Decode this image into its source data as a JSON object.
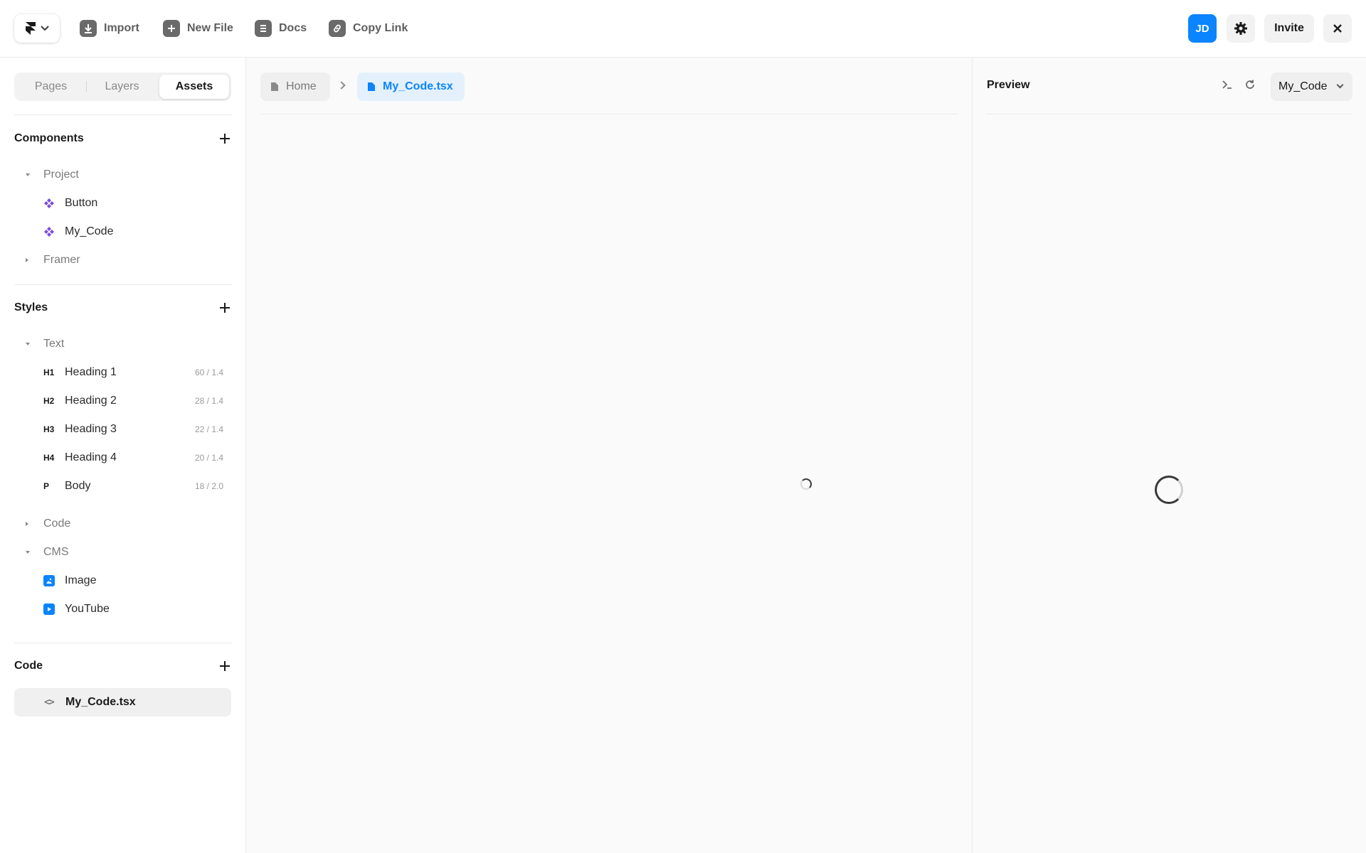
{
  "toolbar": {
    "import_label": "Import",
    "new_file_label": "New File",
    "docs_label": "Docs",
    "copy_link_label": "Copy Link",
    "avatar_initials": "JD",
    "invite_label": "Invite"
  },
  "sidebar": {
    "tabs": [
      "Pages",
      "Layers",
      "Assets"
    ],
    "active_tab": "Assets",
    "components": {
      "title": "Components",
      "project_folder": "Project",
      "items": [
        "Button",
        "My_Code"
      ],
      "framer_folder": "Framer"
    },
    "styles": {
      "title": "Styles",
      "text_folder": "Text",
      "text_styles": [
        {
          "tag": "H1",
          "name": "Heading 1",
          "meta": "60 / 1.4"
        },
        {
          "tag": "H2",
          "name": "Heading 2",
          "meta": "28 / 1.4"
        },
        {
          "tag": "H3",
          "name": "Heading 3",
          "meta": "22 / 1.4"
        },
        {
          "tag": "H4",
          "name": "Heading 4",
          "meta": "20 / 1.4"
        },
        {
          "tag": "P",
          "name": "Body",
          "meta": "18 / 2.0"
        }
      ],
      "code_folder": "Code",
      "cms_folder": "CMS",
      "cms_items": [
        "Image",
        "YouTube"
      ]
    },
    "code": {
      "title": "Code",
      "file": "My_Code.tsx"
    }
  },
  "editor": {
    "breadcrumb_home": "Home",
    "breadcrumb_file": "My_Code.tsx"
  },
  "preview": {
    "title": "Preview",
    "selected_component": "My_Code"
  },
  "colors": {
    "accent": "#0a84ff",
    "component_icon": "#7b4fd6"
  }
}
